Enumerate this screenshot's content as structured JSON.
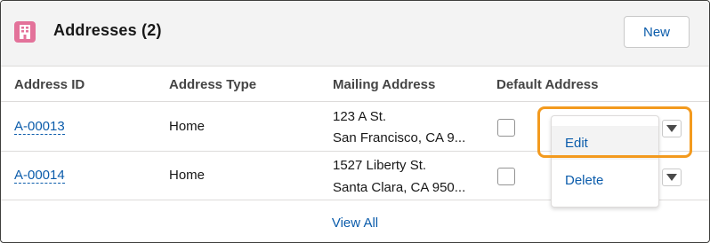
{
  "header": {
    "title": "Addresses (2)",
    "icon": "building-icon",
    "icon_color": "#e3729a",
    "new_button": "New"
  },
  "columns": [
    "Address ID",
    "Address Type",
    "Mailing Address",
    "Default Address"
  ],
  "rows": [
    {
      "id": "A-00013",
      "type": "Home",
      "mailing_line1": "123 A St.",
      "mailing_line2": "San Francisco, CA 9...",
      "default": false
    },
    {
      "id": "A-00014",
      "type": "Home",
      "mailing_line1": "1527 Liberty St.",
      "mailing_line2": "Santa Clara, CA 950...",
      "default": false
    }
  ],
  "row_menu": {
    "items": [
      "Edit",
      "Delete"
    ],
    "hovered": "Edit",
    "highlight_color": "#f39a1e"
  },
  "footer": {
    "view_all": "View All"
  },
  "colors": {
    "link": "#0b5cab",
    "header_bg": "#f3f3f3"
  }
}
